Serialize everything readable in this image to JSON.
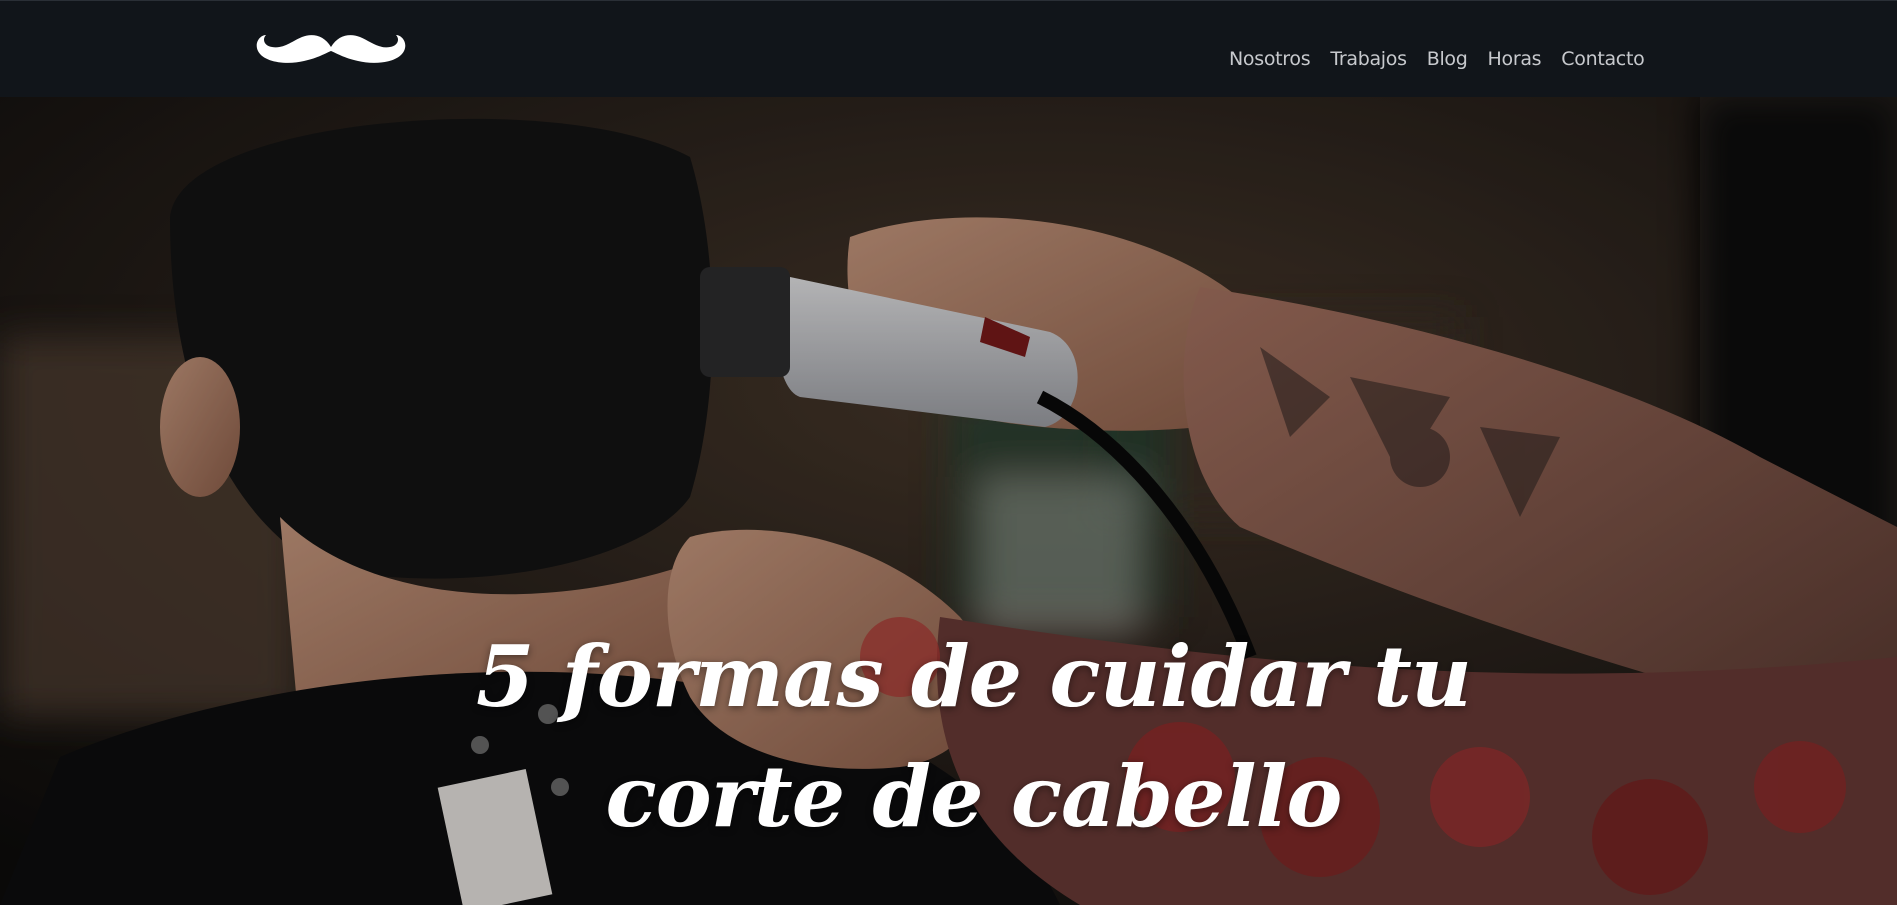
{
  "navbar": {
    "logo_icon": "mustache-icon",
    "links": [
      {
        "label": "Nosotros"
      },
      {
        "label": "Trabajos"
      },
      {
        "label": "Blog"
      },
      {
        "label": "Horas"
      },
      {
        "label": "Contacto"
      }
    ]
  },
  "hero": {
    "title_line_1": "5 formas de cuidar tu",
    "title_line_2": "corte de cabello"
  }
}
